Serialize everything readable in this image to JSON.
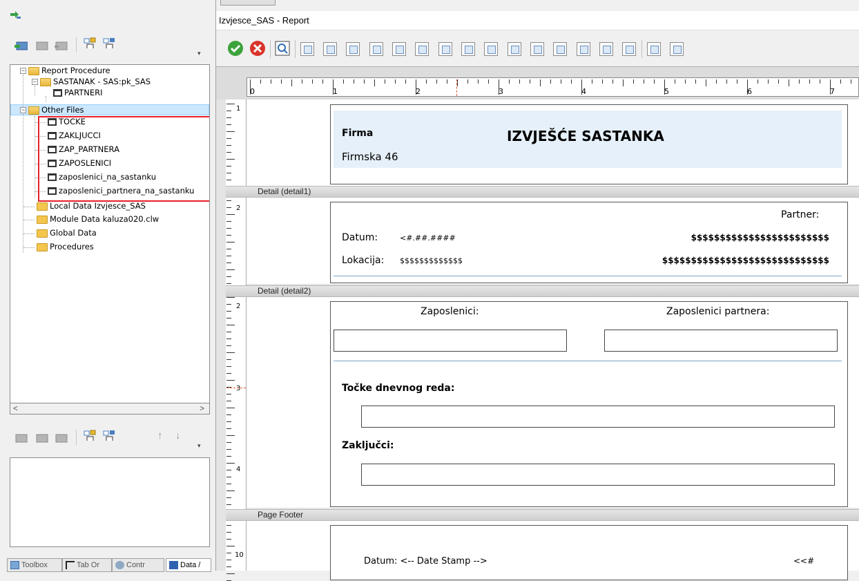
{
  "left": {
    "tree": {
      "items": [
        {
          "label": "Report Procedure"
        },
        {
          "label": "SASTANAK - SAS:pk_SAS"
        },
        {
          "label": "PARTNERI"
        },
        {
          "label": "Other Files"
        },
        {
          "label": "TOCKE"
        },
        {
          "label": "ZAKLJUCCI"
        },
        {
          "label": "ZAP_PARTNERA"
        },
        {
          "label": "ZAPOSLENICI"
        },
        {
          "label": "zaposlenici_na_sastanku"
        },
        {
          "label": "zaposlenici_partnera_na_sastanku"
        },
        {
          "label": "Local Data Izvjesce_SAS"
        },
        {
          "label": "Module Data kaluza020.clw"
        },
        {
          "label": "Global Data"
        },
        {
          "label": "Procedures"
        }
      ]
    },
    "scroll_left": "<",
    "scroll_right": ">",
    "tabs": [
      "Toolbox",
      "Tab Or",
      "Contr",
      "Data /"
    ]
  },
  "right": {
    "window_title": "Izvjesce_SAS - Report",
    "ruler_labels": [
      "0",
      "1",
      "2",
      "3",
      "4",
      "5",
      "6",
      "7"
    ],
    "vruler_labels": [
      "1",
      "2",
      "2",
      "3",
      "4",
      "10"
    ],
    "bands": {
      "detail1": "Detail (detail1)",
      "detail2": "Detail (detail2)",
      "page_footer": "Page Footer"
    },
    "header": {
      "firma": "Firma",
      "title": "IZVJEŠĆE SASTANKA",
      "address": "Firmska 46"
    },
    "detail1": {
      "partner_label": "Partner:",
      "datum_label": "Datum:",
      "datum_value": "<#.##.####",
      "lokacija_label": "Lokacija:",
      "lokacija_value": "$$$$$$$$$$$$$",
      "partner_value1": "$$$$$$$$$$$$$$$$$$$$$$$$",
      "partner_value2": "$$$$$$$$$$$$$$$$$$$$$$$$$$$$$"
    },
    "detail2": {
      "zaposlenici": "Zaposlenici:",
      "zaposlenici_partnera": "Zaposlenici partnera:",
      "tocke": "Točke dnevnog reda:",
      "zakljucci": "Zaključci:"
    },
    "footer": {
      "datum": "Datum: <-- Date Stamp -->",
      "page": "<<#"
    }
  }
}
